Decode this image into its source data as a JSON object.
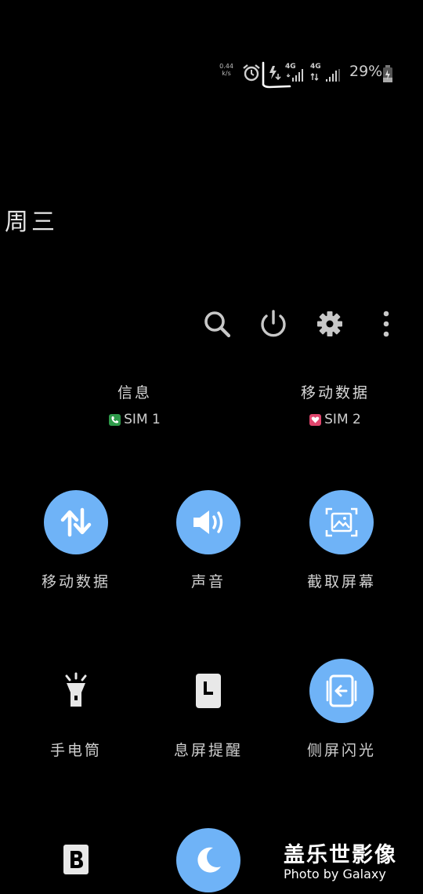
{
  "status": {
    "net_speed_value": "0.44",
    "net_speed_unit": "k/s",
    "sim1_network": "4G",
    "sim2_network": "4G",
    "battery": "29%"
  },
  "day_label": "周三",
  "sims": [
    {
      "title": "信息",
      "sub": "SIM 1",
      "badge_color": "#2e9a4a"
    },
    {
      "title": "移动数据",
      "sub": "SIM 2",
      "badge_color": "#e0466d"
    }
  ],
  "tiles": [
    {
      "label": "移动数据",
      "icon": "data-arrows-icon",
      "state": "on"
    },
    {
      "label": "声音",
      "icon": "speaker-icon",
      "state": "on"
    },
    {
      "label": "截取屏幕",
      "icon": "screenshot-icon",
      "state": "on"
    },
    {
      "label": "手电筒",
      "icon": "flashlight-icon",
      "state": "off"
    },
    {
      "label": "息屏提醒",
      "icon": "clock-card-icon",
      "state": "off"
    },
    {
      "label": "侧屏闪光",
      "icon": "edge-lighting-icon",
      "state": "on"
    }
  ],
  "watermark": {
    "title": "盖乐世影像",
    "sub": "Photo by Galaxy"
  },
  "colors": {
    "accent": "#6fb3f7",
    "background": "#000000"
  }
}
